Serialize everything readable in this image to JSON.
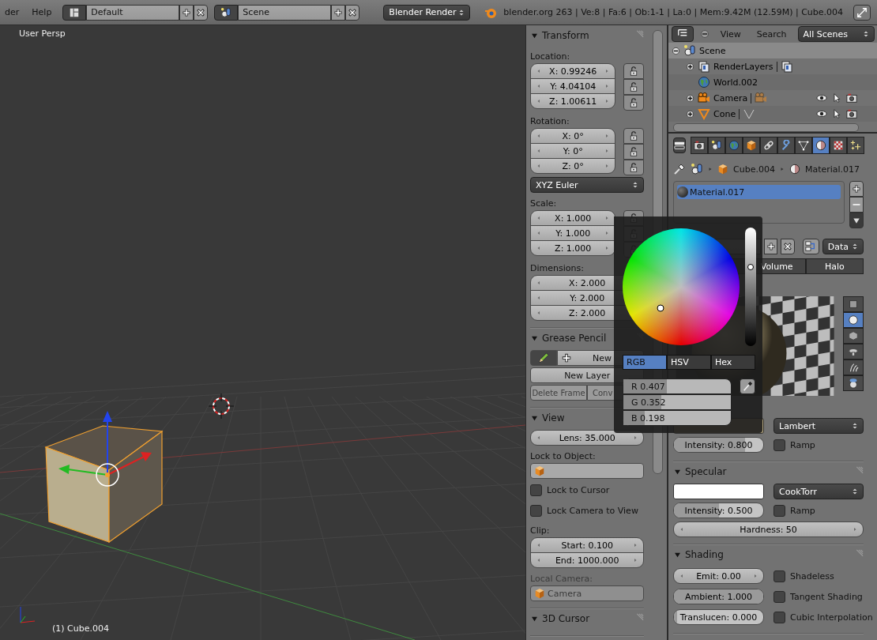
{
  "top_bar": {
    "menus": [
      {
        "label": "der"
      },
      {
        "label": "Help"
      }
    ],
    "screen_layout": "Default",
    "scene": "Scene",
    "render_engine": "Blender Render",
    "stats": "blender.org 263 | Ve:8 | Fa:6 | Ob:1-1 | La:0 | Mem:9.42M (12.59M) | Cube.004"
  },
  "viewport": {
    "view_name": "User Persp",
    "object_label": "(1) Cube.004"
  },
  "n_panel": {
    "panels": [
      {
        "title": "Transform",
        "rows": [
          {
            "kind": "label",
            "text": "Location:"
          },
          {
            "kind": "vector",
            "lockable": true,
            "fields": [
              "X: 0.99246",
              "Y: 4.04104",
              "Z: 1.00611"
            ]
          },
          {
            "kind": "label",
            "text": "Rotation:"
          },
          {
            "kind": "vector",
            "lockable": true,
            "fields": [
              "X: 0°",
              "Y: 0°",
              "Z: 0°"
            ]
          },
          {
            "kind": "dropdown",
            "text": "XYZ Euler"
          },
          {
            "kind": "label",
            "text": "Scale:"
          },
          {
            "kind": "vector",
            "lockable": true,
            "fields": [
              "X: 1.000",
              "Y: 1.000",
              "Z: 1.000"
            ]
          },
          {
            "kind": "label",
            "text": "Dimensions:"
          },
          {
            "kind": "vector",
            "lockable": false,
            "fields": [
              "X: 2.000",
              "Y: 2.000",
              "Z: 2.000"
            ]
          }
        ]
      },
      {
        "title": "Grease Pencil",
        "rows": [
          {
            "kind": "pencil_new",
            "text": "New"
          },
          {
            "kind": "button",
            "text": "New Layer"
          },
          {
            "kind": "buttons",
            "disabled": true,
            "items": [
              "Delete Frame",
              "Conv"
            ]
          }
        ]
      },
      {
        "title": "View",
        "rows": [
          {
            "kind": "number",
            "text": "Lens: 35.000"
          },
          {
            "kind": "label",
            "text": "Lock to Object:"
          },
          {
            "kind": "id_field",
            "disabled": false
          },
          {
            "kind": "checkbox",
            "text": "Lock to Cursor",
            "checked": false
          },
          {
            "kind": "checkbox",
            "text": "Lock Camera to View",
            "checked": false
          },
          {
            "kind": "label",
            "text": "Clip:"
          },
          {
            "kind": "vector",
            "lockable": false,
            "fields": [
              "Start: 0.100",
              "End: 1000.000"
            ]
          },
          {
            "kind": "label",
            "text": "Local Camera:",
            "disabled": true
          },
          {
            "kind": "id_field",
            "text": "Camera",
            "disabled": true
          }
        ]
      },
      {
        "title": "3D Cursor"
      }
    ]
  },
  "outliner": {
    "menus": [
      "View",
      "Search"
    ],
    "filter": "All Scenes",
    "tree": [
      {
        "name": "Scene",
        "kind": "scene",
        "expanded": true,
        "selected": true,
        "children": [
          {
            "name": "RenderLayers",
            "kind": "render_layers",
            "expanded": false,
            "selected": false
          },
          {
            "name": "World.002",
            "kind": "world",
            "selected": false
          },
          {
            "name": "Camera",
            "kind": "camera",
            "expanded": false,
            "selected": false
          },
          {
            "name": "Cone",
            "kind": "cone",
            "expanded": false,
            "selected": false
          }
        ]
      }
    ]
  },
  "properties": {
    "tabs": [
      {
        "kind": "render",
        "selected": false
      },
      {
        "kind": "scene",
        "selected": false
      },
      {
        "kind": "world",
        "selected": false
      },
      {
        "kind": "object",
        "selected": false
      },
      {
        "kind": "constraints",
        "selected": false
      },
      {
        "kind": "modifiers",
        "selected": false
      },
      {
        "kind": "data",
        "selected": false
      },
      {
        "kind": "material",
        "selected": true
      },
      {
        "kind": "texture",
        "selected": false
      },
      {
        "kind": "particles",
        "selected": false
      }
    ],
    "breadcrumb": [
      {
        "kind": "object",
        "text": "Cube.004"
      },
      {
        "kind": "material",
        "text": "Material.017"
      }
    ],
    "slots": [
      {
        "name": "Material.017",
        "selected": true
      }
    ],
    "datablock": {
      "link": "Data"
    },
    "material_tabs": [
      {
        "label": "Volume",
        "selected": false
      },
      {
        "label": "Halo",
        "selected": false
      }
    ],
    "preview_types": [
      {
        "kind": "plane",
        "selected": false
      },
      {
        "kind": "sphere",
        "selected": true
      },
      {
        "kind": "cube",
        "selected": false
      },
      {
        "kind": "monkey",
        "selected": false
      },
      {
        "kind": "hair",
        "selected": false
      },
      {
        "kind": "sky_sphere",
        "selected": false
      }
    ],
    "panels": [
      {
        "rows": [
          {
            "kind": "pair",
            "left": {
              "kind": "swatch",
              "color": "#b5a77f"
            },
            "right": {
              "kind": "dropdown",
              "text": "Lambert"
            }
          },
          {
            "kind": "pair",
            "left": {
              "kind": "slider",
              "text": "Intensity: 0.800",
              "level": 0.8
            },
            "right": {
              "kind": "checkbox",
              "text": "Ramp",
              "checked": false
            }
          }
        ]
      },
      {
        "title": "Specular",
        "rows": [
          {
            "kind": "pair",
            "left": {
              "kind": "swatch",
              "color": "#ffffff"
            },
            "right": {
              "kind": "dropdown",
              "text": "CookTorr"
            }
          },
          {
            "kind": "pair",
            "left": {
              "kind": "slider",
              "text": "Intensity: 0.500",
              "level": 0.5
            },
            "right": {
              "kind": "checkbox",
              "text": "Ramp",
              "checked": false
            }
          },
          {
            "kind": "number",
            "text": "Hardness: 50"
          }
        ]
      },
      {
        "title": "Shading",
        "rows": [
          {
            "kind": "pair",
            "left": {
              "kind": "number",
              "text": "Emit: 0.00"
            },
            "right": {
              "kind": "checkbox",
              "text": "Shadeless",
              "checked": false
            }
          },
          {
            "kind": "pair",
            "left": {
              "kind": "slider",
              "text": "Ambient: 1.000",
              "level": 1.0
            },
            "right": {
              "kind": "checkbox",
              "text": "Tangent Shading",
              "checked": false
            }
          },
          {
            "kind": "pair",
            "left": {
              "kind": "slider",
              "text": "Translucen: 0.000",
              "level": 0.0
            },
            "right": {
              "kind": "checkbox",
              "text": "Cubic Interpolation",
              "checked": false
            }
          }
        ]
      }
    ]
  },
  "color_picker": {
    "value_slider": {
      "level": 0.67
    },
    "modes": [
      {
        "label": "RGB",
        "selected": true
      },
      {
        "label": "HSV",
        "selected": false
      },
      {
        "label": "Hex",
        "selected": false
      }
    ],
    "channels": [
      {
        "text": "R 0.407",
        "level": 0.407
      },
      {
        "text": "G 0.352",
        "level": 0.352
      },
      {
        "text": "B 0.198",
        "level": 0.198
      }
    ]
  }
}
